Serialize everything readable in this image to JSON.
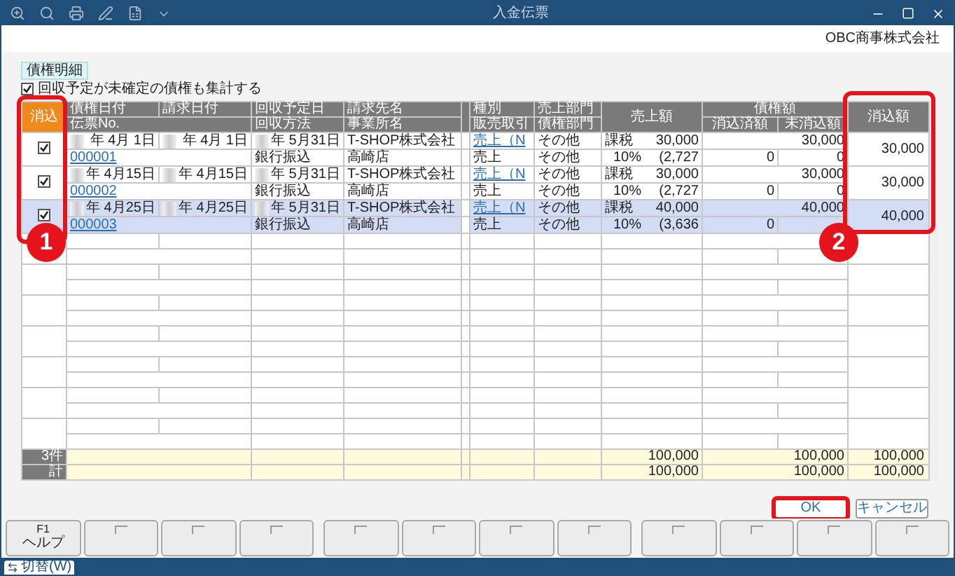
{
  "window": {
    "title": "入金伝票"
  },
  "company": "OBC商事株式会社",
  "section_tag": "債権明細",
  "include_unconfirmed": {
    "label": "回収予定が未確定の債権も集計する",
    "checked": true
  },
  "table": {
    "header_top": [
      "消込",
      "債権日付",
      "請求日付",
      "回収予定日",
      "請求先名",
      "種別",
      "売上部門",
      "売上額",
      "債権額",
      "消込額"
    ],
    "header_bottom": [
      "伝票No.",
      "回収方法",
      "事業所名",
      "販売取引",
      "債権部門",
      "消込済額",
      "未消込額"
    ],
    "rows": [
      {
        "checked": true,
        "selected": false,
        "debt_date": "年  4月  1日",
        "invoice_date": "年  4月  1日",
        "due_date": "年  5月31日",
        "customer": "T-SHOP株式会社",
        "slip_no": "000001",
        "method": "銀行振込",
        "office": "高崎店",
        "type": "売上（N",
        "sales_type": "売上",
        "dept": "その他",
        "debt_dept": "その他",
        "tax": "課税",
        "rate": "10%",
        "amount": "30,000",
        "tax_amount": "(2,727",
        "cleared": "0",
        "uncleared": "30,000",
        "uncleared_2": "0",
        "applied": "30,000"
      },
      {
        "checked": true,
        "selected": false,
        "debt_date": "年  4月15日",
        "invoice_date": "年  4月15日",
        "due_date": "年  5月31日",
        "customer": "T-SHOP株式会社",
        "slip_no": "000002",
        "method": "銀行振込",
        "office": "高崎店",
        "type": "売上（N",
        "sales_type": "売上",
        "dept": "その他",
        "debt_dept": "その他",
        "tax": "課税",
        "rate": "10%",
        "amount": "30,000",
        "tax_amount": "(2,727",
        "cleared": "0",
        "uncleared": "30,000",
        "uncleared_2": "0",
        "applied": "30,000"
      },
      {
        "checked": true,
        "selected": true,
        "debt_date": "年  4月25日",
        "invoice_date": "年  4月25日",
        "due_date": "年  5月31日",
        "customer": "T-SHOP株式会社",
        "slip_no": "000003",
        "method": "銀行振込",
        "office": "高崎店",
        "type": "売上（N",
        "sales_type": "売上",
        "dept": "その他",
        "debt_dept": "その他",
        "tax": "課税",
        "rate": "10%",
        "amount": "40,000",
        "tax_amount": "(3,636",
        "cleared": "0",
        "uncleared": "40,000",
        "applied": "40,000"
      }
    ],
    "totals": [
      {
        "label": "3件",
        "amount": "100,000",
        "uncleared": "100,000",
        "applied": "100,000"
      },
      {
        "label": "計",
        "amount": "100,000",
        "uncleared": "100,000",
        "applied": "100,000"
      }
    ]
  },
  "buttons": [
    {
      "label": "OK",
      "highlighted": true
    },
    {
      "label": "キャンセル",
      "highlighted": false
    }
  ],
  "function_keys": [
    {
      "key": "F1",
      "label": "ヘルプ"
    }
  ],
  "status_bar": {
    "switch_button": "切替(W)"
  },
  "callouts": [
    {
      "number": "1"
    },
    {
      "number": "2"
    }
  ]
}
